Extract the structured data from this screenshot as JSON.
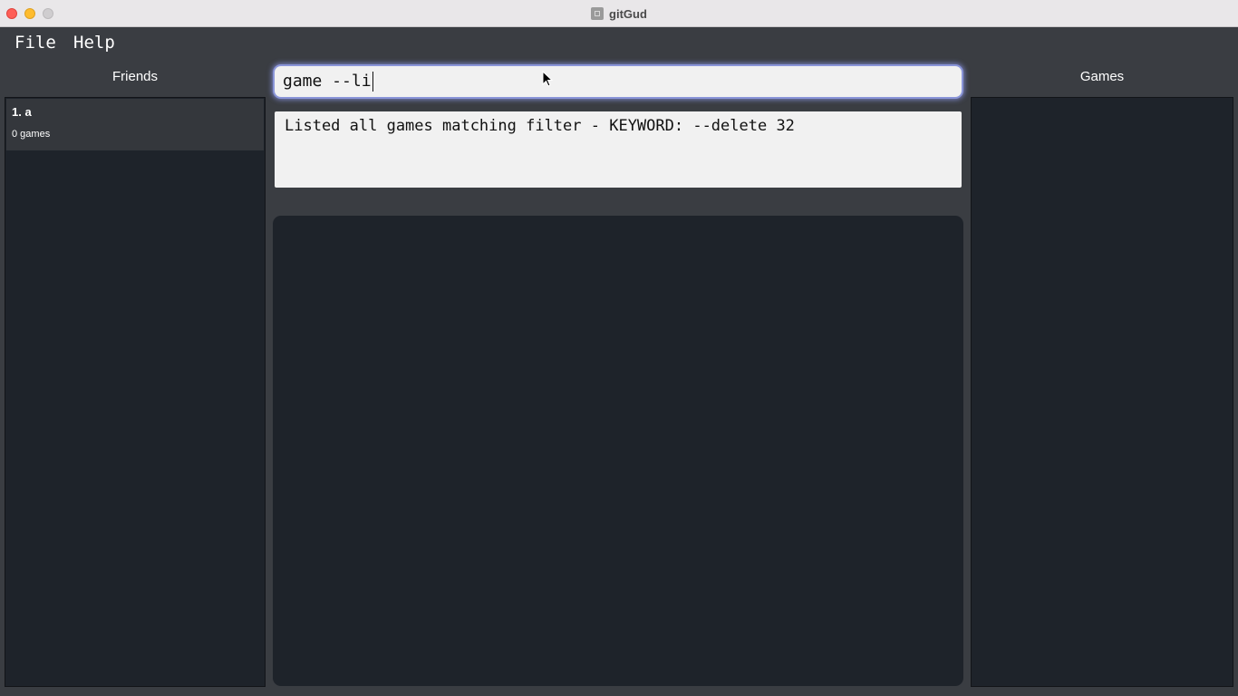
{
  "window": {
    "title": "gitGud"
  },
  "menu": {
    "items": [
      "File",
      "Help"
    ]
  },
  "friends": {
    "header": "Friends",
    "items": [
      {
        "name": "1. a",
        "games": "0 games"
      }
    ]
  },
  "command": {
    "value": "game --li"
  },
  "result": {
    "text": "Listed all games matching filter - KEYWORD: --delete 32"
  },
  "games": {
    "header": "Games"
  }
}
